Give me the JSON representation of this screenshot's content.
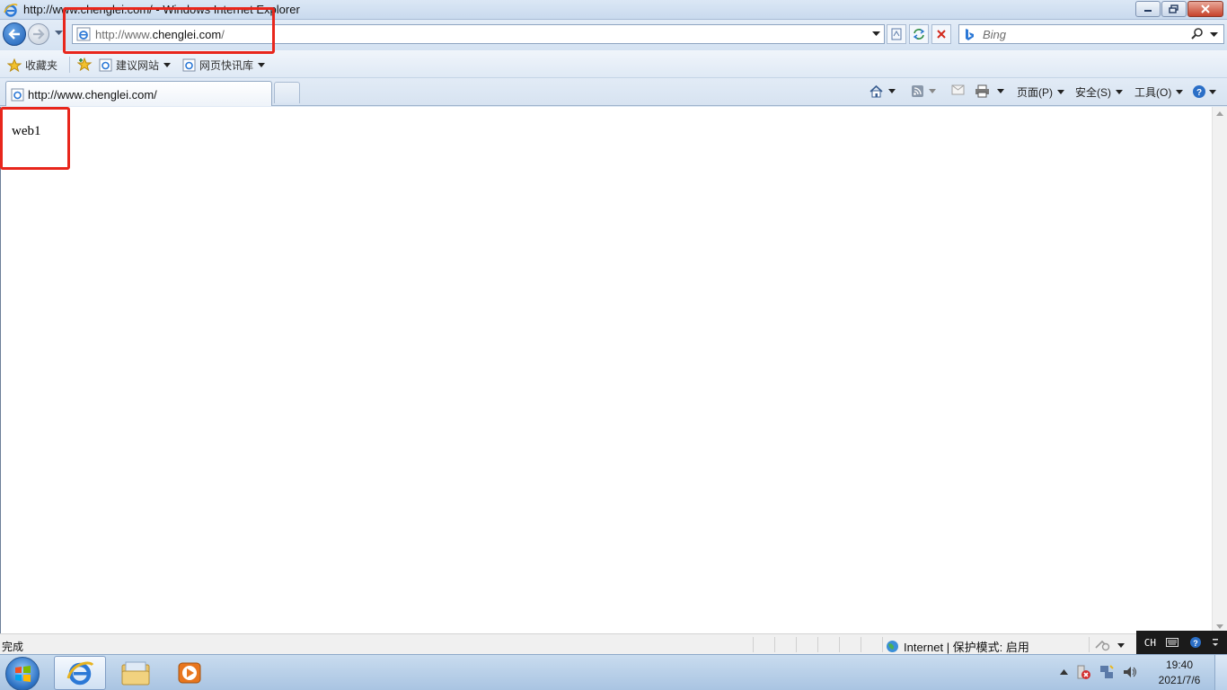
{
  "window": {
    "title": "http://www.chenglei.com/ - Windows Internet Explorer"
  },
  "navigation": {
    "address_url_scheme": "http://www.",
    "address_url_host": "chenglei.com",
    "address_url_path": "/",
    "search_placeholder": "Bing"
  },
  "favorites_bar": {
    "favorites_label": "收藏夹",
    "items": [
      {
        "label": "建议网站",
        "icon": "ie-page-icon"
      },
      {
        "label": "网页快讯库",
        "icon": "ie-page-icon"
      }
    ]
  },
  "tabs": [
    {
      "label": "http://www.chenglei.com/",
      "active": true
    }
  ],
  "command_bar": {
    "page": "页面(P)",
    "safety": "安全(S)",
    "tools": "工具(O)"
  },
  "page": {
    "body_text": "web1"
  },
  "status_bar": {
    "status": "完成",
    "zone": "Internet | 保护模式: 启用"
  },
  "language_bar": {
    "lang": "CH"
  },
  "taskbar": {
    "apps": [
      "internet-explorer",
      "windows-explorer",
      "media-player"
    ],
    "time": "19:40",
    "date": "2021/7/6"
  },
  "colors": {
    "annotation_red": "#e8261c",
    "ie_blue": "#1d5fb5"
  }
}
